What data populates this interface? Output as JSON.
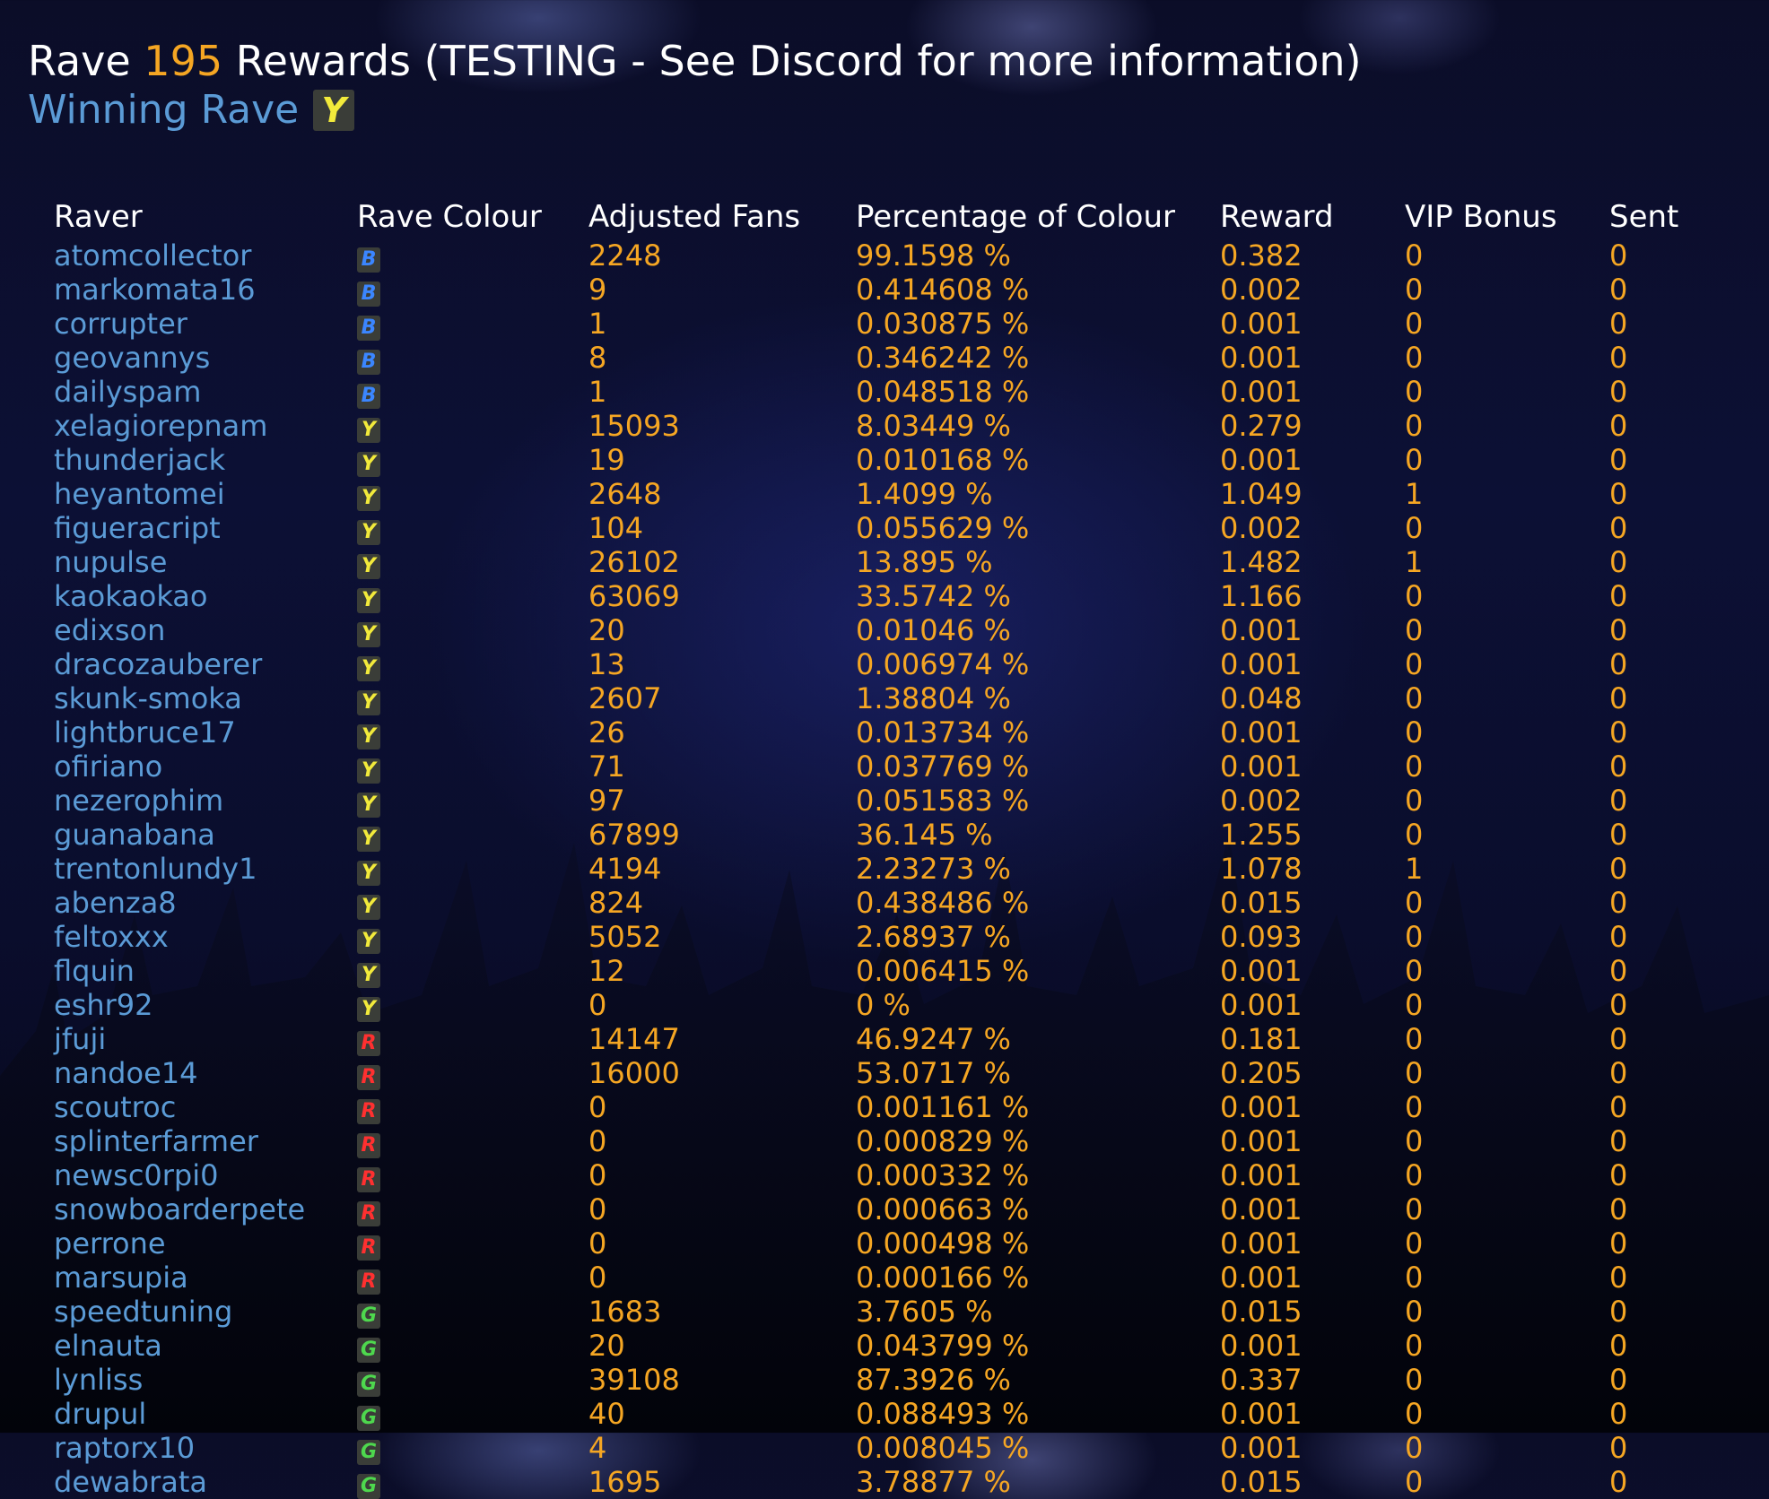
{
  "header": {
    "title_prefix": "Rave",
    "rave_number": "195",
    "title_suffix": "Rewards (TESTING - See Discord for more information)",
    "winning_label": "Winning Rave",
    "winning_colour": "Y"
  },
  "colours": {
    "B": "#3b86ff",
    "Y": "#f2ea3b",
    "R": "#ff3030",
    "G": "#4ed84e",
    "name_text": "#5b9bd6",
    "value_text": "#f5a623",
    "badge_bg": "#3a3d38"
  },
  "table": {
    "headers": [
      "Raver",
      "Rave Colour",
      "Adjusted Fans",
      "Percentage of Colour",
      "Reward",
      "VIP Bonus",
      "Sent"
    ],
    "rows": [
      {
        "raver": "atomcollector",
        "colour": "B",
        "fans": "2248",
        "pct": "99.1598 %",
        "reward": "0.382",
        "vip": "0",
        "sent": "0"
      },
      {
        "raver": "markomata16",
        "colour": "B",
        "fans": "9",
        "pct": "0.414608 %",
        "reward": "0.002",
        "vip": "0",
        "sent": "0"
      },
      {
        "raver": "corrupter",
        "colour": "B",
        "fans": "1",
        "pct": "0.030875 %",
        "reward": "0.001",
        "vip": "0",
        "sent": "0"
      },
      {
        "raver": "geovannys",
        "colour": "B",
        "fans": "8",
        "pct": "0.346242 %",
        "reward": "0.001",
        "vip": "0",
        "sent": "0"
      },
      {
        "raver": "dailyspam",
        "colour": "B",
        "fans": "1",
        "pct": "0.048518 %",
        "reward": "0.001",
        "vip": "0",
        "sent": "0"
      },
      {
        "raver": "xelagiorepnam",
        "colour": "Y",
        "fans": "15093",
        "pct": "8.03449 %",
        "reward": "0.279",
        "vip": "0",
        "sent": "0"
      },
      {
        "raver": "thunderjack",
        "colour": "Y",
        "fans": "19",
        "pct": "0.010168 %",
        "reward": "0.001",
        "vip": "0",
        "sent": "0"
      },
      {
        "raver": "heyantomei",
        "colour": "Y",
        "fans": "2648",
        "pct": "1.4099 %",
        "reward": "1.049",
        "vip": "1",
        "sent": "0"
      },
      {
        "raver": "figueracript",
        "colour": "Y",
        "fans": "104",
        "pct": "0.055629 %",
        "reward": "0.002",
        "vip": "0",
        "sent": "0"
      },
      {
        "raver": "nupulse",
        "colour": "Y",
        "fans": "26102",
        "pct": "13.895 %",
        "reward": "1.482",
        "vip": "1",
        "sent": "0"
      },
      {
        "raver": "kaokaokao",
        "colour": "Y",
        "fans": "63069",
        "pct": "33.5742 %",
        "reward": "1.166",
        "vip": "0",
        "sent": "0"
      },
      {
        "raver": "edixson",
        "colour": "Y",
        "fans": "20",
        "pct": "0.01046 %",
        "reward": "0.001",
        "vip": "0",
        "sent": "0"
      },
      {
        "raver": "dracozauberer",
        "colour": "Y",
        "fans": "13",
        "pct": "0.006974 %",
        "reward": "0.001",
        "vip": "0",
        "sent": "0"
      },
      {
        "raver": "skunk-smoka",
        "colour": "Y",
        "fans": "2607",
        "pct": "1.38804 %",
        "reward": "0.048",
        "vip": "0",
        "sent": "0"
      },
      {
        "raver": "lightbruce17",
        "colour": "Y",
        "fans": "26",
        "pct": "0.013734 %",
        "reward": "0.001",
        "vip": "0",
        "sent": "0"
      },
      {
        "raver": "ofiriano",
        "colour": "Y",
        "fans": "71",
        "pct": "0.037769 %",
        "reward": "0.001",
        "vip": "0",
        "sent": "0"
      },
      {
        "raver": "nezerophim",
        "colour": "Y",
        "fans": "97",
        "pct": "0.051583 %",
        "reward": "0.002",
        "vip": "0",
        "sent": "0"
      },
      {
        "raver": "guanabana",
        "colour": "Y",
        "fans": "67899",
        "pct": "36.145 %",
        "reward": "1.255",
        "vip": "0",
        "sent": "0"
      },
      {
        "raver": "trentonlundy1",
        "colour": "Y",
        "fans": "4194",
        "pct": "2.23273 %",
        "reward": "1.078",
        "vip": "1",
        "sent": "0"
      },
      {
        "raver": "abenza8",
        "colour": "Y",
        "fans": "824",
        "pct": "0.438486 %",
        "reward": "0.015",
        "vip": "0",
        "sent": "0"
      },
      {
        "raver": "feltoxxx",
        "colour": "Y",
        "fans": "5052",
        "pct": "2.68937 %",
        "reward": "0.093",
        "vip": "0",
        "sent": "0"
      },
      {
        "raver": "flquin",
        "colour": "Y",
        "fans": "12",
        "pct": "0.006415 %",
        "reward": "0.001",
        "vip": "0",
        "sent": "0"
      },
      {
        "raver": "eshr92",
        "colour": "Y",
        "fans": "0",
        "pct": "0 %",
        "reward": "0.001",
        "vip": "0",
        "sent": "0"
      },
      {
        "raver": "jfuji",
        "colour": "R",
        "fans": "14147",
        "pct": "46.9247 %",
        "reward": "0.181",
        "vip": "0",
        "sent": "0"
      },
      {
        "raver": "nandoe14",
        "colour": "R",
        "fans": "16000",
        "pct": "53.0717 %",
        "reward": "0.205",
        "vip": "0",
        "sent": "0"
      },
      {
        "raver": "scoutroc",
        "colour": "R",
        "fans": "0",
        "pct": "0.001161 %",
        "reward": "0.001",
        "vip": "0",
        "sent": "0"
      },
      {
        "raver": "splinterfarmer",
        "colour": "R",
        "fans": "0",
        "pct": "0.000829 %",
        "reward": "0.001",
        "vip": "0",
        "sent": "0"
      },
      {
        "raver": "newsc0rpi0",
        "colour": "R",
        "fans": "0",
        "pct": "0.000332 %",
        "reward": "0.001",
        "vip": "0",
        "sent": "0"
      },
      {
        "raver": "snowboarderpete",
        "colour": "R",
        "fans": "0",
        "pct": "0.000663 %",
        "reward": "0.001",
        "vip": "0",
        "sent": "0"
      },
      {
        "raver": "perrone",
        "colour": "R",
        "fans": "0",
        "pct": "0.000498 %",
        "reward": "0.001",
        "vip": "0",
        "sent": "0"
      },
      {
        "raver": "marsupia",
        "colour": "R",
        "fans": "0",
        "pct": "0.000166 %",
        "reward": "0.001",
        "vip": "0",
        "sent": "0"
      },
      {
        "raver": "speedtuning",
        "colour": "G",
        "fans": "1683",
        "pct": "3.7605 %",
        "reward": "0.015",
        "vip": "0",
        "sent": "0"
      },
      {
        "raver": "elnauta",
        "colour": "G",
        "fans": "20",
        "pct": "0.043799 %",
        "reward": "0.001",
        "vip": "0",
        "sent": "0"
      },
      {
        "raver": "lynliss",
        "colour": "G",
        "fans": "39108",
        "pct": "87.3926 %",
        "reward": "0.337",
        "vip": "0",
        "sent": "0"
      },
      {
        "raver": "drupul",
        "colour": "G",
        "fans": "40",
        "pct": "0.088493 %",
        "reward": "0.001",
        "vip": "0",
        "sent": "0"
      },
      {
        "raver": "raptorx10",
        "colour": "G",
        "fans": "4",
        "pct": "0.008045 %",
        "reward": "0.001",
        "vip": "0",
        "sent": "0"
      },
      {
        "raver": "dewabrata",
        "colour": "G",
        "fans": "1695",
        "pct": "3.78877 %",
        "reward": "0.015",
        "vip": "0",
        "sent": "0"
      }
    ]
  }
}
